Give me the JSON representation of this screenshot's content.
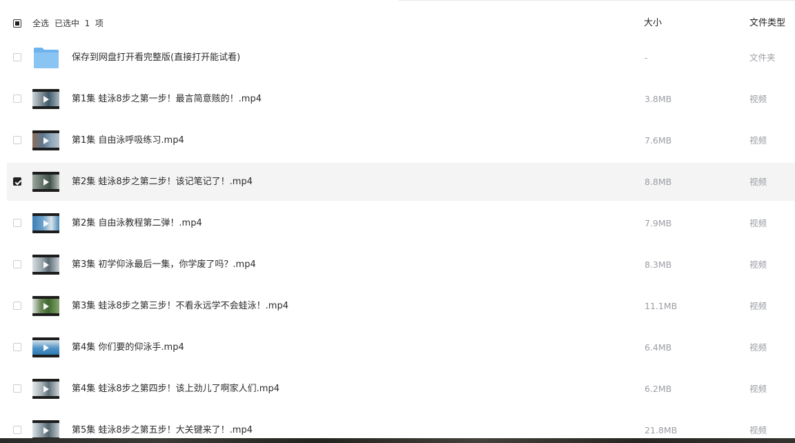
{
  "header": {
    "select_all": "全选",
    "selected_count": "已选中  1  项",
    "size_col": "大小",
    "type_col": "文件类型"
  },
  "colors": {
    "folder_blue": "#8ac4f2",
    "selected_row_bg": "#f4f4f5",
    "muted_text": "#9a9da3"
  },
  "files": [
    {
      "name": "保存到网盘打开看完整版(直接打开能试看)",
      "size": "-",
      "type": "文件夹",
      "icon": "folder-icon",
      "selected": false
    },
    {
      "name": "第1集  蛙泳8步之第一步！最言简意赅的！.mp4",
      "size": "3.8MB",
      "type": "视频",
      "icon": "video-thumbnail",
      "selected": false
    },
    {
      "name": "第1集  自由泳呼吸练习.mp4",
      "size": "7.6MB",
      "type": "视频",
      "icon": "video-thumbnail",
      "selected": false
    },
    {
      "name": "第2集  蛙泳8步之第二步！该记笔记了！.mp4",
      "size": "8.8MB",
      "type": "视频",
      "icon": "video-thumbnail",
      "selected": true
    },
    {
      "name": "第2集  自由泳教程第二弹！.mp4",
      "size": "7.9MB",
      "type": "视频",
      "icon": "video-thumbnail",
      "selected": false
    },
    {
      "name": "第3集  初学仰泳最后一集，你学废了吗？.mp4",
      "size": "8.3MB",
      "type": "视频",
      "icon": "video-thumbnail",
      "selected": false
    },
    {
      "name": "第3集  蛙泳8步之第三步！不看永远学不会蛙泳！.mp4",
      "size": "11.1MB",
      "type": "视频",
      "icon": "video-thumbnail",
      "selected": false
    },
    {
      "name": "第4集  你们要的仰泳手.mp4",
      "size": "6.4MB",
      "type": "视频",
      "icon": "video-thumbnail",
      "selected": false
    },
    {
      "name": "第4集  蛙泳8步之第四步！该上劲儿了啊家人们.mp4",
      "size": "6.2MB",
      "type": "视频",
      "icon": "video-thumbnail",
      "selected": false
    },
    {
      "name": "第5集  蛙泳8步之第五步！大关键来了！.mp4",
      "size": "21.8MB",
      "type": "视频",
      "icon": "video-thumbnail",
      "selected": false
    }
  ]
}
